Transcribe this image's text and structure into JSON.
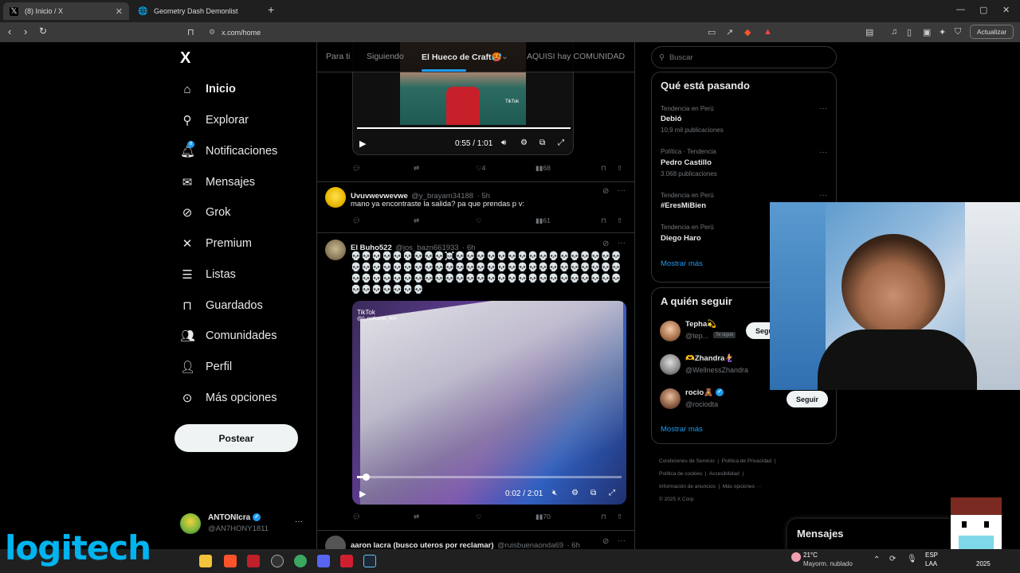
{
  "browser": {
    "tabs": [
      {
        "title": "(8) Inicio / X",
        "active": true
      },
      {
        "title": "Geometry Dash Demonlist",
        "active": false
      }
    ],
    "new_tab": "+",
    "url": "x.com/home",
    "update_label": "Actualizar"
  },
  "sidebar": {
    "logo": "X",
    "items": [
      {
        "label": "Inicio",
        "icon": "home-icon"
      },
      {
        "label": "Explorar",
        "icon": "search-icon"
      },
      {
        "label": "Notificaciones",
        "icon": "bell-icon",
        "badge": "8"
      },
      {
        "label": "Mensajes",
        "icon": "mail-icon"
      },
      {
        "label": "Grok",
        "icon": "grok-icon"
      },
      {
        "label": "Premium",
        "icon": "x-icon"
      },
      {
        "label": "Listas",
        "icon": "list-icon"
      },
      {
        "label": "Guardados",
        "icon": "bookmark-icon"
      },
      {
        "label": "Comunidades",
        "icon": "people-icon"
      },
      {
        "label": "Perfil",
        "icon": "person-icon"
      },
      {
        "label": "Más opciones",
        "icon": "more-circle-icon"
      }
    ],
    "post_button": "Postear",
    "profile": {
      "name": "ANTONIcra",
      "handle": "@AN7HONY1811",
      "more": "···"
    }
  },
  "feed": {
    "tabs": [
      "Para ti",
      "Siguiendo",
      "El Hueco de Craft🥵",
      "AQUISI hay COMUNIDAD"
    ],
    "posts": [
      {
        "video_time": "0:55 / 1:01",
        "watermark": "TikTok",
        "actions": {
          "replies": "",
          "reposts": "",
          "likes": "4",
          "views": "68"
        }
      },
      {
        "name": "Uvuvwevwevwe",
        "handle": "@y_brayam34188",
        "time": "· 5h",
        "text": "mano ya encontraste la salida? pa que prendas p v:",
        "actions": {
          "replies": "",
          "reposts": "",
          "likes": "",
          "views": "61"
        }
      },
      {
        "name": "El Buho522",
        "handle": "@jos_bazn661933",
        "time": "· 6h",
        "text": "💀💀💀💀💀💀💀💀💀☠️💀💀💀💀💀💀💀💀💀💀💀💀💀💀💀💀💀💀💀💀💀💀💀💀💀💀💀💀💀💀💀💀💀💀💀💀💀💀💀💀💀💀💀💀💀💀💀💀💀💀💀💀💀💀💀💀💀💀💀💀💀💀💀💀💀💀💀💀💀💀💀💀💀💀💀",
        "video_time": "0:02 / 2:01",
        "watermark": "TikTok",
        "watermark_handle": "@0_notfound_404",
        "actions": {
          "replies": "",
          "reposts": "",
          "likes": "",
          "views": "70"
        }
      },
      {
        "name": "aaron lacra (busco uteros por reclamar)",
        "handle": "@ruisbuenaonda69",
        "time": "· 6h"
      }
    ]
  },
  "right": {
    "search_placeholder": "Buscar",
    "trending_title": "Qué está pasando",
    "trends": [
      {
        "meta": "Tendencia en Perú",
        "name": "Debió",
        "count": "10,9 mil publicaciones"
      },
      {
        "meta": "Política · Tendencia",
        "name": "Pedro Castillo",
        "count": "3.068 publicaciones"
      },
      {
        "meta": "Tendencia en Perú",
        "name": "#EresMiBien",
        "count": ""
      },
      {
        "meta": "Tendencia en Perú",
        "name": "Diego Haro",
        "count": ""
      }
    ],
    "show_more": "Mostrar más",
    "follow_title": "A quién seguir",
    "follow": [
      {
        "name": "Tepha💫",
        "handle": "@tep...",
        "follows_you": "Te sigue",
        "button": "Seguir"
      },
      {
        "name": "🫶Zhandra🧜‍♀️",
        "handle": "@WellnessZhandra",
        "button": ""
      },
      {
        "name": "rocio🧸",
        "handle": "@rociodta",
        "button": "Seguir"
      }
    ],
    "footer": {
      "row1": [
        "Condiciones de Servicio",
        "Política de Privacidad"
      ],
      "row2": [
        "Política de cookies",
        "Accesibilidad"
      ],
      "row3": [
        "Información de anuncios",
        "Más opciones ···"
      ],
      "copyright": "© 2025 X Corp."
    }
  },
  "messages_drawer": {
    "title": "Mensajes"
  },
  "taskbar": {
    "weather_temp": "21°C",
    "weather_desc": "Mayorm. nublado",
    "lang": "ESP",
    "lang2": "LAA",
    "clock_year": "2025"
  },
  "overlay": {
    "brand": "logitech"
  },
  "colors": {
    "accent": "#1d9bf0",
    "background": "#000000",
    "border": "#2f3336"
  }
}
